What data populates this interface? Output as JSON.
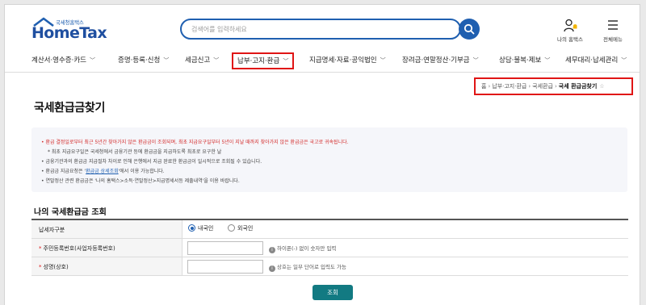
{
  "header": {
    "logo_subtitle": "국세청홈택스",
    "logo_text": "HomeTax",
    "search_placeholder": "검색어를 입력하세요",
    "my_hometax_label": "나의 홈택스",
    "all_menu_label": "전체메뉴"
  },
  "nav": {
    "items": [
      {
        "label": "계산서·영수증·카드",
        "highlighted": false
      },
      {
        "label": "증명·등록·신청",
        "highlighted": false
      },
      {
        "label": "세금신고",
        "highlighted": false
      },
      {
        "label": "납부·고지·환급",
        "highlighted": true
      },
      {
        "label": "지급명세·자료·공익법인",
        "highlighted": false
      },
      {
        "label": "장려금·연말정산·기부금",
        "highlighted": false
      },
      {
        "label": "상담·불복·제보",
        "highlighted": false
      },
      {
        "label": "세무대리·납세관리",
        "highlighted": false
      }
    ]
  },
  "breadcrumb": {
    "items": [
      "홈",
      "납부·고지·환급",
      "국세환급"
    ],
    "current": "국세 환급금찾기"
  },
  "page_title": "국세환급금찾기",
  "notice": {
    "lines": [
      {
        "text": "• 환급 결정일로부터 최근 5년간 찾아가지 않은 환급금이 조회되며, 최초 지급요구일부터 5년이 지날 때까지 찾아가지 않은 환급금은 국고로 귀속됩니다.",
        "red": true
      },
      {
        "text": "* 최초 지급요구일은 국세청에서 금융기관 등에 환급금을 지급하도록 최초로 요구한 날",
        "red": false
      },
      {
        "text": "• 금융기관과의 환급금 지급절차 차이로 인해 은행에서 지급 완료한 환급금이 일시적으로 조회될 수 있습니다.",
        "red": false
      },
      {
        "text_before": "• 환급금 지급요청은 '",
        "link": "환급금 상세조회",
        "text_after": "'에서 이용 가능합니다.",
        "red": false
      },
      {
        "text": "• 연말정산 관련 환급금은 '나의 홈택스>소득·연말정산>지급명세서등 제출내역'을 이용 바랍니다.",
        "red": false
      }
    ]
  },
  "section_title": "나의 국세환급금 조회",
  "form": {
    "taxpayer_type_label": "납세자구분",
    "radio_domestic": "내국인",
    "radio_foreign": "외국인",
    "selected": "내국인",
    "id_label": "주민등록번호(사업자등록번호)",
    "id_value": "",
    "id_hint": "하이픈(-) 없이 숫자만 입력",
    "name_label": "성명(상호)",
    "name_value": "",
    "name_hint": "상호는 일부 단어로 입력도 가능",
    "required_mark": "*",
    "info_icon": "i"
  },
  "submit_label": "조회",
  "colors": {
    "brand_blue": "#1f5fb0",
    "highlight_red": "#e01515",
    "button_teal": "#127a82"
  }
}
